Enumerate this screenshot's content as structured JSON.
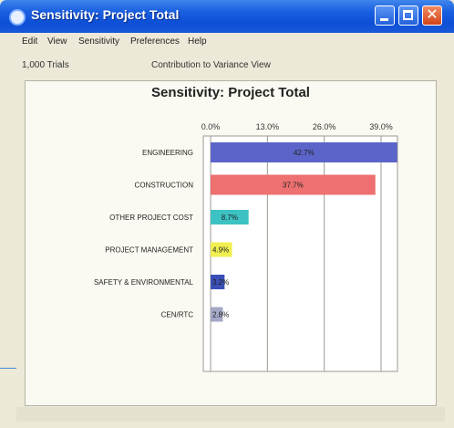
{
  "window": {
    "title": "Sensitivity: Project Total",
    "close_glyph": "✕"
  },
  "menu": [
    "Edit",
    "View",
    "Sensitivity",
    "Preferences",
    "Help"
  ],
  "info": {
    "trials": "1,000 Trials",
    "view": "Contribution to Variance View"
  },
  "chart_data": {
    "type": "bar",
    "orientation": "horizontal",
    "title": "Sensitivity: Project Total",
    "xlim": [
      0,
      0.39
    ],
    "x_ticks": [
      "0.0%",
      "13.0%",
      "26.0%",
      "39.0%"
    ],
    "x_tick_values": [
      0,
      0.13,
      0.26,
      0.39
    ],
    "grid": true,
    "categories": [
      "ENGINEERING",
      "CONSTRUCTION",
      "OTHER PROJECT COST",
      "PROJECT MANAGEMENT",
      "SAFETY & ENVIRONMENTAL",
      "CEN/RTC"
    ],
    "values": [
      0.427,
      0.377,
      0.087,
      0.049,
      0.032,
      0.028
    ],
    "labels": [
      "42.7%",
      "37.7%",
      "8.7%",
      "4.9%",
      "3.2%",
      "2.8%"
    ],
    "colors": [
      "#5b64c8",
      "#ee7070",
      "#3cc2c2",
      "#f0ef52",
      "#3a4fb6",
      "#a4a7c6"
    ]
  }
}
